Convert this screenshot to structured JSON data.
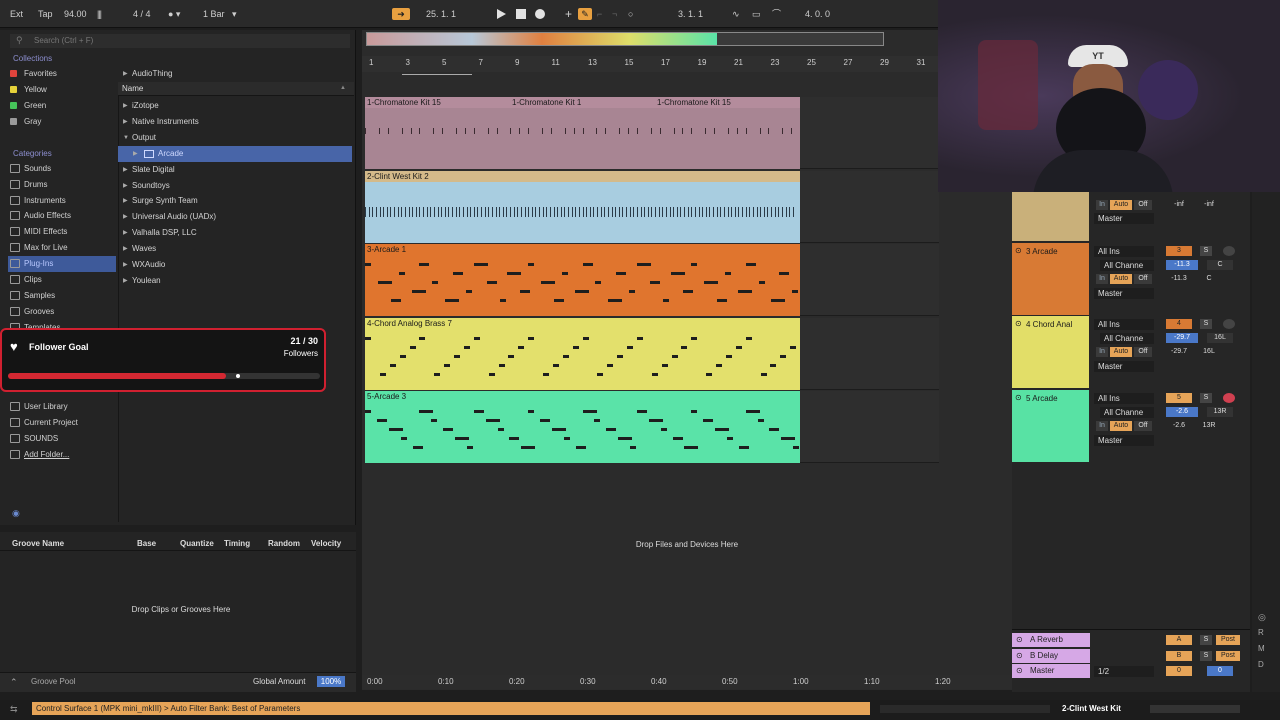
{
  "toolbar": {
    "ext": "Ext",
    "tap": "Tap",
    "tempo": "94.00",
    "signature": "4 / 4",
    "quantize": "1 Bar",
    "position": "25.  1.  1",
    "loop_start": "3.  1.  1",
    "loop_length": "4.  0.  0"
  },
  "browser": {
    "search_placeholder": "Search (Ctrl + F)",
    "collections_header": "Collections",
    "collections": [
      {
        "label": "Favorites",
        "color": "#e0443c"
      },
      {
        "label": "Yellow",
        "color": "#e6d23a"
      },
      {
        "label": "Green",
        "color": "#46c35a"
      },
      {
        "label": "Gray",
        "color": "#9a9a9a"
      }
    ],
    "categories_header": "Categories",
    "categories": [
      "Sounds",
      "Drums",
      "Instruments",
      "Audio Effects",
      "MIDI Effects",
      "Max for Live",
      "Plug-Ins",
      "Clips",
      "Samples",
      "Grooves",
      "Templates"
    ],
    "places": [
      "User Library",
      "Current Project",
      "SOUNDS",
      "Add Folder..."
    ],
    "name_header": "Name",
    "names": [
      "AudioThing",
      "iZotope",
      "Native Instruments",
      "Output",
      "Arcade",
      "Slate Digital",
      "Soundtoys",
      "Surge Synth Team",
      "Universal Audio (UADx)",
      "Valhalla DSP, LLC",
      "Waves",
      "WXAudio",
      "Youlean"
    ]
  },
  "follower_goal": {
    "title": "Follower Goal",
    "count": "21 / 30",
    "unit": "Followers",
    "progress": 0.7
  },
  "groove_pool": {
    "columns": [
      "Groove Name",
      "Base",
      "Quantize",
      "Timing",
      "Random",
      "Velocity"
    ],
    "drop_text": "Drop Clips or Grooves Here",
    "footer": "Groove Pool",
    "global_amount_label": "Global Amount",
    "global_amount": "100%"
  },
  "arrangement": {
    "ruler": [
      "1",
      "3",
      "5",
      "7",
      "9",
      "11",
      "13",
      "15",
      "17",
      "19",
      "21",
      "23",
      "25",
      "27",
      "29",
      "31"
    ],
    "tracks": [
      {
        "header": "1-Chromatone Kit 15",
        "clips": [
          "1-Chromatone Kit 15",
          "1-Chromatone Kit 1",
          "1-Chromatone Kit 15"
        ],
        "color": "#b48c9c",
        "body": "#a88593"
      },
      {
        "header": "2-Clint West Kit 2",
        "clips": [
          "2-Clint West Kit 2"
        ],
        "color": "#d4ba8a",
        "body": "#a8cde0"
      },
      {
        "header": "3-Arcade 1",
        "clips": [
          "3-Arcade 1"
        ],
        "color": "#e0752e",
        "body": "#e0752e"
      },
      {
        "header": "4-Chord Analog Brass 7",
        "clips": [
          "4-Chord Analog Brass 7"
        ],
        "color": "#e3e06c",
        "body": "#e3e06c"
      },
      {
        "header": "5-Arcade 3",
        "clips": [
          "5-Arcade 3"
        ],
        "color": "#5ae3a8",
        "body": "#5ae3a8"
      }
    ],
    "drop_text": "Drop Files and Devices Here",
    "time_marks": [
      "0:00",
      "0:10",
      "0:20",
      "0:30",
      "0:40",
      "0:50",
      "1:00",
      "1:10",
      "1:20"
    ]
  },
  "mixer": {
    "channels": [
      {
        "name": "",
        "color": "#c9b07a",
        "input": "",
        "channel": "",
        "track_no": "",
        "volume": "-inf",
        "pan": "-inf",
        "output": "Master"
      },
      {
        "name": "3 Arcade",
        "color": "#d87a34",
        "input": "All Ins",
        "channel": "All Channe",
        "track_no": "3",
        "volume": "-11.3",
        "pan": "C",
        "output": "Master"
      },
      {
        "name": "4 Chord Anal",
        "color": "#e2de68",
        "input": "All Ins",
        "channel": "All Channe",
        "track_no": "4",
        "volume": "-29.7",
        "pan": "16L",
        "output": "Master"
      },
      {
        "name": "5 Arcade",
        "color": "#58e2a4",
        "input": "All Ins",
        "channel": "All Channe",
        "track_no": "5",
        "volume": "-2.6",
        "pan": "13R",
        "output": "Master"
      }
    ],
    "monitor": {
      "in": "In",
      "auto": "Auto",
      "off": "Off",
      "minus_inf": "-inf"
    },
    "solo": "S",
    "returns": [
      {
        "name": "A Reverb",
        "letter": "A",
        "post": "Post"
      },
      {
        "name": "B Delay",
        "letter": "B",
        "post": "Post"
      }
    ],
    "master": {
      "name": "Master",
      "cue": "1/2",
      "vol": "0",
      "pan": "0"
    }
  },
  "status": {
    "message": "Control Surface 1 (MPK mini_mkIII) > Auto Filter Bank: Best of Parameters",
    "selected_track": "2-Clint West Kit"
  },
  "cam": {
    "cap_text": "YT"
  }
}
